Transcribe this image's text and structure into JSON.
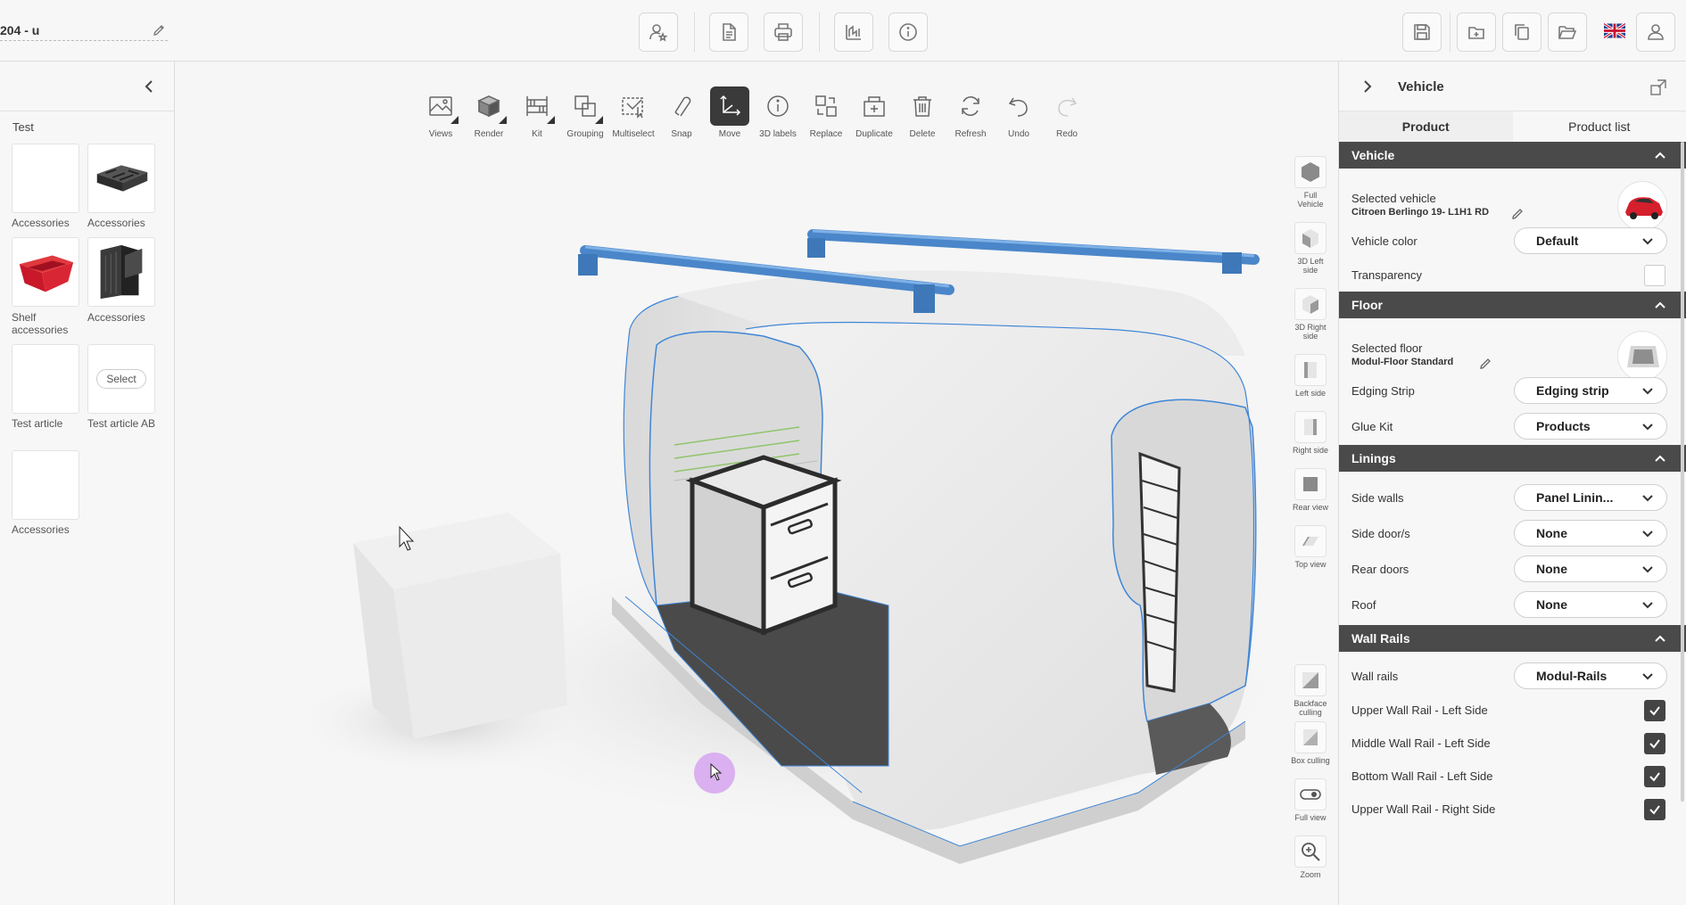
{
  "project": {
    "title": "204 - u"
  },
  "toolbar_top": {
    "center": [
      "user-star-icon",
      "document-icon",
      "printer-icon",
      "drawing-icon",
      "info-icon"
    ],
    "right": [
      "save-icon",
      "new-file-icon",
      "copy-icon",
      "open-folder-icon",
      "uk-flag-icon",
      "user-icon"
    ]
  },
  "left_panel": {
    "group_title": "Test",
    "tiles": [
      {
        "label": "Accessories"
      },
      {
        "label": "Accessories"
      },
      {
        "label": "Shelf accessories"
      },
      {
        "label": "Accessories"
      },
      {
        "label": "Test article"
      },
      {
        "label": "Test article AB",
        "button": "Select"
      },
      {
        "label": "Accessories"
      }
    ]
  },
  "viewport_tools": [
    {
      "label": "Views"
    },
    {
      "label": "Render"
    },
    {
      "label": "Kit"
    },
    {
      "label": "Grouping"
    },
    {
      "label": "Multiselect"
    },
    {
      "label": "Snap"
    },
    {
      "label": "Move"
    },
    {
      "label": "3D labels"
    },
    {
      "label": "Replace"
    },
    {
      "label": "Duplicate"
    },
    {
      "label": "Delete"
    },
    {
      "label": "Refresh"
    },
    {
      "label": "Undo"
    },
    {
      "label": "Redo"
    }
  ],
  "view_tools": [
    {
      "label": "Full Vehicle"
    },
    {
      "label": "3D Left side"
    },
    {
      "label": "3D Right side"
    },
    {
      "label": "Left side"
    },
    {
      "label": "Right side"
    },
    {
      "label": "Rear view"
    },
    {
      "label": "Top view"
    },
    {
      "label": "Backface culling"
    },
    {
      "label": "Box culling"
    },
    {
      "label": "Full view"
    },
    {
      "label": "Zoom"
    }
  ],
  "right_panel": {
    "title": "Vehicle",
    "tabs": [
      "Product",
      "Product list"
    ],
    "vehicle": {
      "section": "Vehicle",
      "selected_label": "Selected vehicle",
      "selected_value": "Citroen Berlingo 19- L1H1 RD",
      "color_label": "Vehicle color",
      "color_value": "Default",
      "transparency_label": "Transparency"
    },
    "floor": {
      "section": "Floor",
      "selected_label": "Selected floor",
      "selected_value": "Modul-Floor Standard",
      "edging_label": "Edging Strip",
      "edging_value": "Edging strip",
      "glue_label": "Glue Kit",
      "glue_value": "Products"
    },
    "linings": {
      "section": "Linings",
      "rows": [
        {
          "label": "Side walls",
          "value": "Panel Linin..."
        },
        {
          "label": "Side door/s",
          "value": "None"
        },
        {
          "label": "Rear doors",
          "value": "None"
        },
        {
          "label": "Roof",
          "value": "None"
        }
      ]
    },
    "wall_rails": {
      "section": "Wall Rails",
      "rails_label": "Wall rails",
      "rails_value": "Modul-Rails",
      "checks": [
        {
          "label": "Upper Wall Rail - Left Side",
          "checked": true
        },
        {
          "label": "Middle Wall Rail - Left Side",
          "checked": true
        },
        {
          "label": "Bottom Wall Rail - Left Side",
          "checked": true
        },
        {
          "label": "Upper Wall Rail - Right Side",
          "checked": true
        }
      ]
    }
  }
}
